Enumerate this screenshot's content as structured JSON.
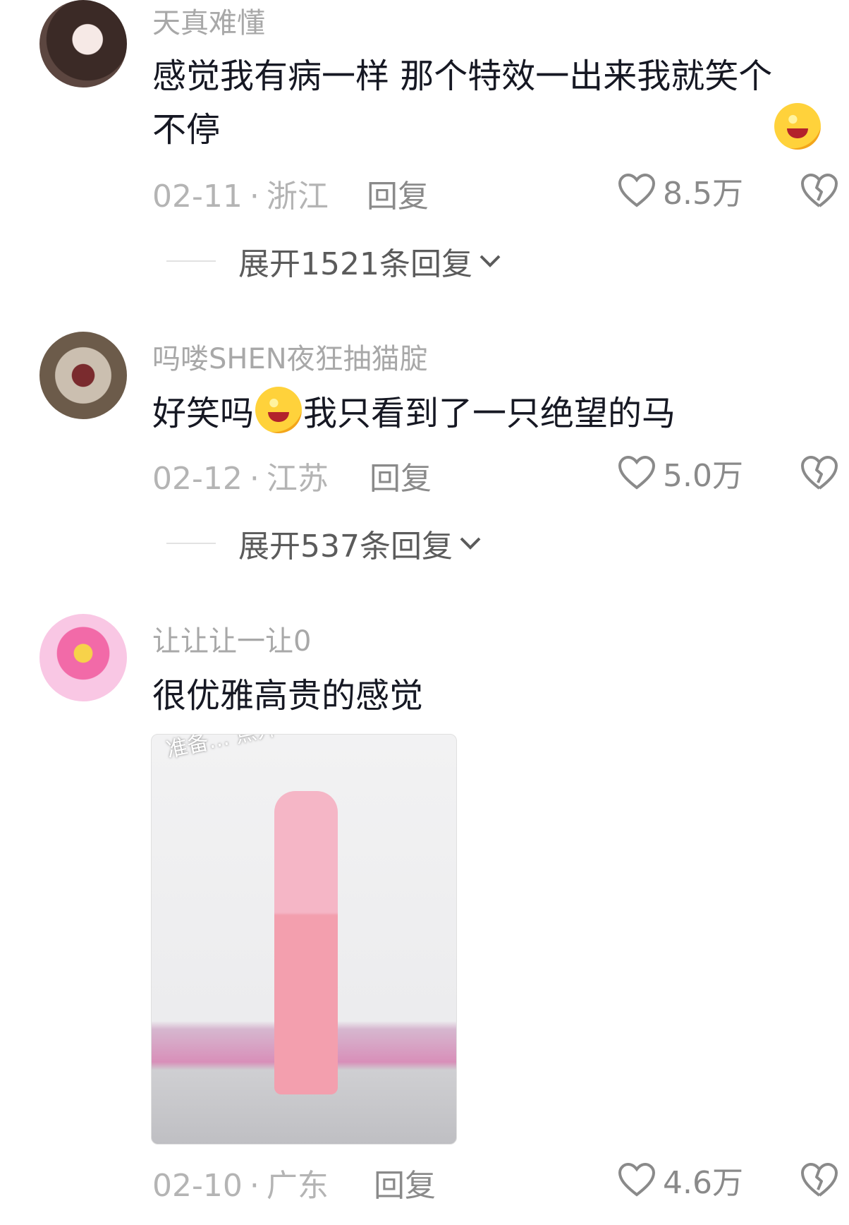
{
  "comments": [
    {
      "username": "天真难懂",
      "text_parts": [
        "感觉我有病一样 那个特效一出来我就笑个不停"
      ],
      "date": "02-11",
      "region": "浙江",
      "reply_label": "回复",
      "likes": "8.5万",
      "expand_label": "展开1521条回复"
    },
    {
      "username": "吗喽SHEN夜狂抽猫腚",
      "text_before": "好笑吗",
      "text_after": "我只看到了一只绝望的马",
      "date": "02-12",
      "region": "江苏",
      "reply_label": "回复",
      "likes": "5.0万",
      "expand_label": "展开537条回复"
    },
    {
      "username": "让让让一让0",
      "text": "很优雅高贵的感觉",
      "photo_caption": "准备… 点开一看 天塌了 。。。",
      "date": "02-10",
      "region": "广东",
      "reply_label": "回复",
      "likes": "4.6万"
    }
  ],
  "separator": "·",
  "icons": {
    "like": "heart-outline-icon",
    "dislike": "broken-heart-icon",
    "expand": "chevron-down-icon",
    "emoji": "grin-emoji-icon"
  },
  "colors": {
    "username": "#a8a8a8",
    "text": "#161823",
    "meta": "#b4b4b4"
  }
}
